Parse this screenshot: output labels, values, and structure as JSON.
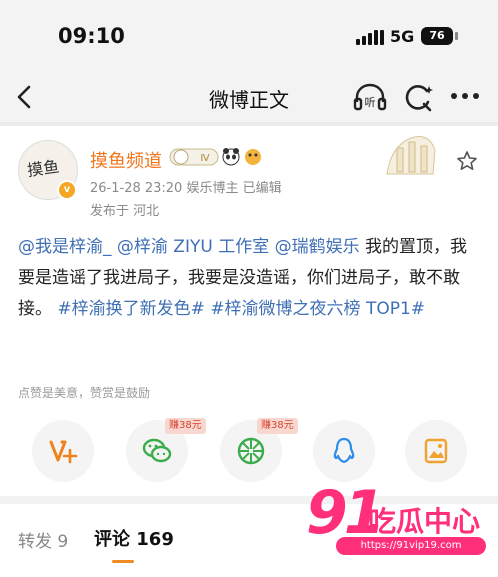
{
  "status_bar": {
    "time": "09:10",
    "network": "5G",
    "battery": "76"
  },
  "nav": {
    "title": "微博正文",
    "listen_label": "听"
  },
  "post": {
    "author": "摸鱼频道",
    "level_badge": "Ⅳ",
    "vip_mark": "v",
    "meta": "26-1-28 23:20  娱乐博主  已编辑",
    "location": "发布于 河北",
    "avatar_text": "摸鱼",
    "body": {
      "mention1": "@我是梓渝_",
      "mention2": "@梓渝 ZIYU 工作室",
      "mention3": "@瑞鹤娱乐",
      "text1": " 我的置顶，我要是造谣了我进局子，我要是没造谣，你们进局子，敢不敢接。 ",
      "hashtag1": "#梓渝换了新发色#",
      "hashtag2": "#梓渝微博之夜六榜 TOP1#"
    }
  },
  "support_hint": "点赞是美意，赞赏是鼓励",
  "actions": {
    "wechat_tag": "赚38元",
    "moments_tag": "赚38元"
  },
  "tabs": {
    "repost": "转发 9",
    "comments": "评论 169"
  },
  "watermark": {
    "number": "91",
    "title": "吃瓜中心",
    "url": "https://91vip19.com"
  },
  "colors": {
    "accent_orange": "#f0761e",
    "link_blue": "#3f6fb5",
    "watermark_pink": "#ff2f7a"
  }
}
